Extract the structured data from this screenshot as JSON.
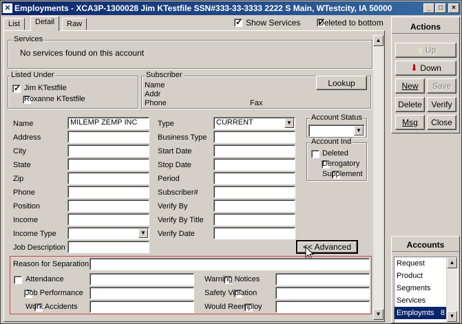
{
  "window": {
    "title": "Employments - XCA3P-1300028  Jim KTestfile  SSN#333-33-3333  2222 S Main, WTestcity, IA 50000",
    "buttons": {
      "minimize": "_",
      "maximize": "□",
      "close": "×"
    }
  },
  "tabs": [
    "List",
    "Detail",
    "Raw"
  ],
  "toolbar": {
    "show_services": {
      "label": "Show Services",
      "checked": true
    },
    "deleted_to_bottom": {
      "label": "Deleted to bottom",
      "checked": true
    }
  },
  "services": {
    "group_label": "Services",
    "message": "No services found on this account"
  },
  "listed_under": {
    "group_label": "Listed Under",
    "items": [
      {
        "name": "Jim KTestfile",
        "checked": true
      },
      {
        "name": "Roxanne KTestfile",
        "checked": false
      }
    ]
  },
  "subscriber": {
    "group_label": "Subscriber",
    "name_label": "Name",
    "addr_label": "Addr",
    "phone_label": "Phone",
    "fax_label": "Fax",
    "lookup_button": "Lookup"
  },
  "form_left": {
    "name_label": "Name",
    "name_value": "MILEMP ZEMP INC",
    "address_label": "Address",
    "city_label": "City",
    "state_label": "State",
    "zip_label": "Zip",
    "phone_label": "Phone",
    "position_label": "Position",
    "income_label": "Income",
    "income_type_label": "Income Type",
    "job_description_label": "Job Description"
  },
  "form_mid": {
    "type_label": "Type",
    "type_value": "CURRENT",
    "business_type_label": "Business Type",
    "start_date_label": "Start Date",
    "stop_date_label": "Stop Date",
    "period_label": "Period",
    "subscriber_num_label": "Subscriber#",
    "verify_by_label": "Verify By",
    "verify_by_title_label": "Verify By Title",
    "verify_date_label": "Verify Date"
  },
  "account_status": {
    "group_label": "Account Status",
    "value": ""
  },
  "account_ind": {
    "group_label": "Account Ind",
    "items": [
      {
        "label": "Deleted",
        "checked": false
      },
      {
        "label": "Derogatory",
        "checked": false
      },
      {
        "label": "Supplement",
        "checked": false
      }
    ]
  },
  "advanced_button": "<< Advanced",
  "separation": {
    "reason_label": "Reason for Separation",
    "left_items": [
      {
        "label": "Attendance",
        "checked": false
      },
      {
        "label": "Job Performance",
        "checked": false
      },
      {
        "label": "Work Accidents",
        "checked": false
      }
    ],
    "right_items": [
      {
        "label": "Warning Notices",
        "checked": false
      },
      {
        "label": "Safety Violation",
        "checked": false
      },
      {
        "label": "Would Reemploy",
        "checked": false
      }
    ]
  },
  "actions": {
    "header": "Actions",
    "up": "Up",
    "down": "Down",
    "new": "New",
    "save": "Save",
    "delete": "Delete",
    "verify": "Verify",
    "msg": "Msg",
    "close": "Close"
  },
  "accounts": {
    "header": "Accounts",
    "items": [
      {
        "label": "Request",
        "count": ""
      },
      {
        "label": "Product",
        "count": ""
      },
      {
        "label": "Segments",
        "count": ""
      },
      {
        "label": "Services",
        "count": ""
      },
      {
        "label": "Employmts",
        "count": "8"
      }
    ]
  },
  "colors": {
    "title_start": "#0a246a",
    "title_end": "#3a6ea5",
    "face": "#d4d0c8",
    "separation_border": "#d04040",
    "down_arrow": "#cc0000",
    "up_arrow": "#d8d0a0"
  }
}
